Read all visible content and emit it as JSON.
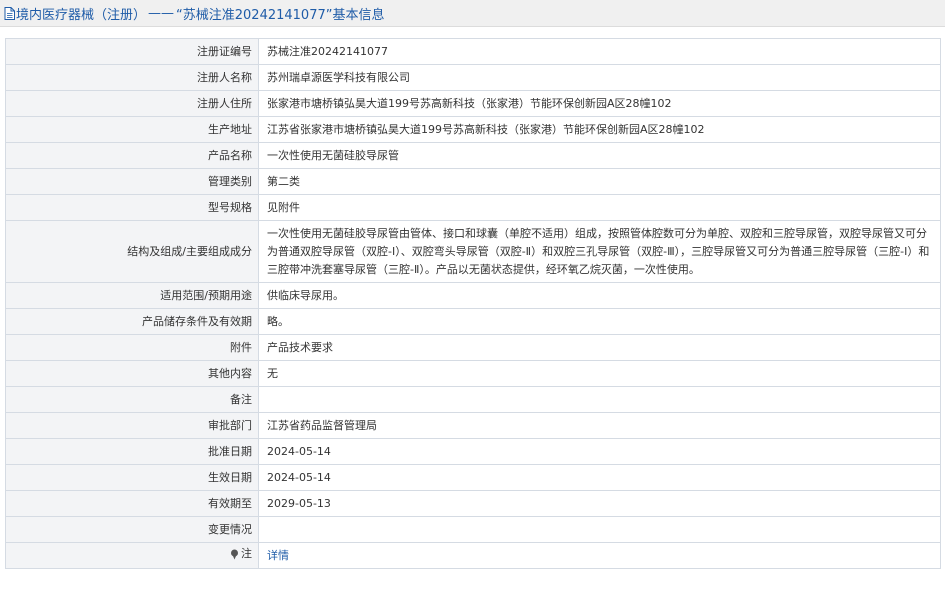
{
  "header": {
    "breadcrumb": "境内医疗器械（注册）",
    "separator": "——",
    "title": "“苏械注准20242141077”基本信息"
  },
  "rows": [
    {
      "label": "注册证编号",
      "value": "苏械注准20242141077"
    },
    {
      "label": "注册人名称",
      "value": "苏州瑞卓源医学科技有限公司"
    },
    {
      "label": "注册人住所",
      "value": "张家港市塘桥镇弘昊大道199号苏高新科技（张家港）节能环保创新园A区28幢102"
    },
    {
      "label": "生产地址",
      "value": "江苏省张家港市塘桥镇弘昊大道199号苏高新科技（张家港）节能环保创新园A区28幢102"
    },
    {
      "label": "产品名称",
      "value": "一次性使用无菌硅胶导尿管"
    },
    {
      "label": "管理类别",
      "value": "第二类"
    },
    {
      "label": "型号规格",
      "value": "见附件"
    },
    {
      "label": "结构及组成/主要组成成分",
      "value": "一次性使用无菌硅胶导尿管由管体、接口和球囊（单腔不适用）组成，按照管体腔数可分为单腔、双腔和三腔导尿管，双腔导尿管又可分为普通双腔导尿管（双腔-Ⅰ）、双腔弯头导尿管（双腔-Ⅱ）和双腔三孔导尿管（双腔-Ⅲ），三腔导尿管又可分为普通三腔导尿管（三腔-Ⅰ）和三腔带冲洗套塞导尿管（三腔-Ⅱ）。产品以无菌状态提供，经环氧乙烷灭菌，一次性使用。"
    },
    {
      "label": "适用范围/预期用途",
      "value": "供临床导尿用。"
    },
    {
      "label": "产品储存条件及有效期",
      "value": "略。"
    },
    {
      "label": "附件",
      "value": "产品技术要求"
    },
    {
      "label": "其他内容",
      "value": "无"
    },
    {
      "label": "备注",
      "value": ""
    },
    {
      "label": "审批部门",
      "value": "江苏省药品监督管理局"
    },
    {
      "label": "批准日期",
      "value": "2024-05-14"
    },
    {
      "label": "生效日期",
      "value": "2024-05-14"
    },
    {
      "label": "有效期至",
      "value": "2029-05-13"
    },
    {
      "label": "变更情况",
      "value": ""
    }
  ],
  "note_row": {
    "label": "注",
    "link": "详情"
  },
  "icons": {
    "header": "document-icon",
    "note": "pin-icon"
  },
  "colors": {
    "link": "#1f5ca8",
    "label_bg": "#f3f4f6",
    "border": "#d5dbe3",
    "header_bg": "#f0f0f0"
  }
}
